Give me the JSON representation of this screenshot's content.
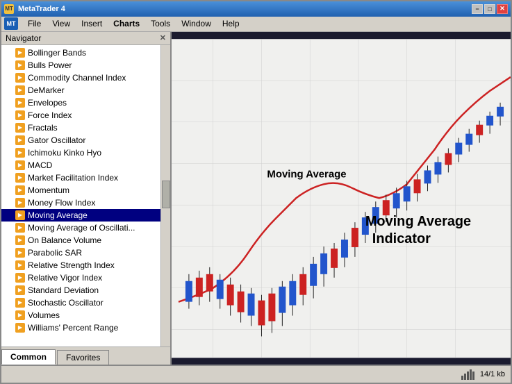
{
  "titleBar": {
    "title": "MetaTrader 4",
    "minimize": "−",
    "maximize": "□",
    "close": "✕"
  },
  "menuBar": {
    "appIcon": "MT",
    "items": [
      "File",
      "View",
      "Insert",
      "Charts",
      "Tools",
      "Window",
      "Help"
    ]
  },
  "navigator": {
    "title": "Navigator",
    "closeBtn": "✕",
    "items": [
      "Bollinger Bands",
      "Bulls Power",
      "Commodity Channel Index",
      "DeMarker",
      "Envelopes",
      "Force Index",
      "Fractals",
      "Gator Oscillator",
      "Ichimoku Kinko Hyo",
      "MACD",
      "Market Facilitation Index",
      "Momentum",
      "Money Flow Index",
      "Moving Average",
      "Moving Average of Oscillati...",
      "On Balance Volume",
      "Parabolic SAR",
      "Relative Strength Index",
      "Relative Vigor Index",
      "Standard Deviation",
      "Stochastic Oscillator",
      "Volumes",
      "Williams' Percent Range"
    ],
    "selectedIndex": 13,
    "tabs": [
      "Common",
      "Favorites"
    ]
  },
  "chart": {
    "annotation1": "Moving Average",
    "annotation2": "Moving Average\nIndicator",
    "bgColor": "#f5f5f5"
  },
  "statusBar": {
    "kbLabel": "14/1 kb"
  }
}
